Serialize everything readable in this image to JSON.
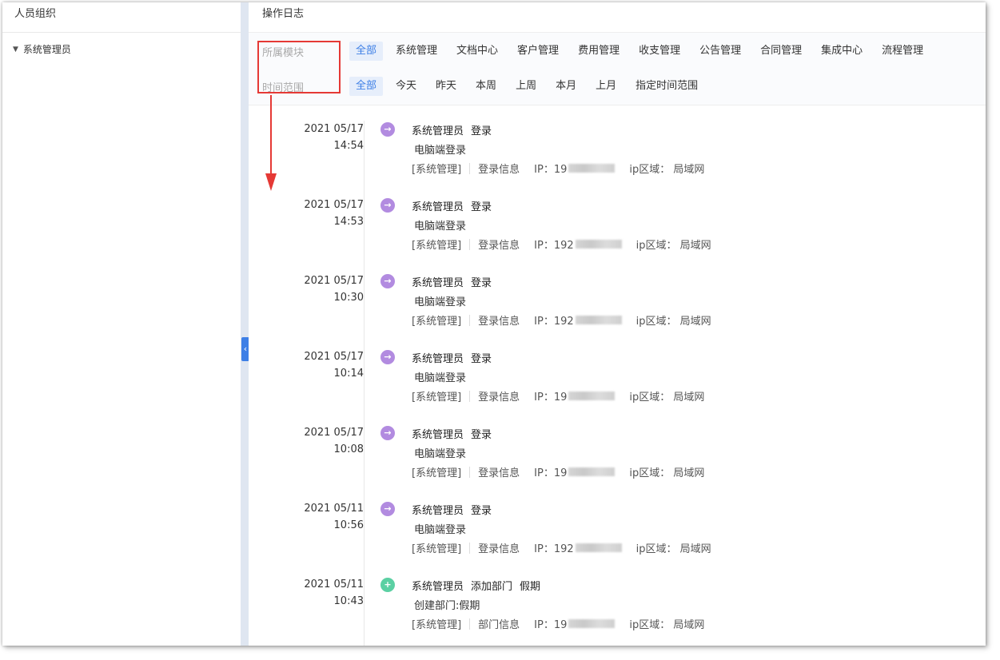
{
  "left_panel": {
    "title": "人员组织",
    "tree": [
      {
        "label": "系统管理员",
        "expanded": true
      }
    ]
  },
  "main": {
    "title": "操作日志",
    "filters": {
      "module_label": "所属模块",
      "modules": [
        "全部",
        "系统管理",
        "文档中心",
        "客户管理",
        "费用管理",
        "收支管理",
        "公告管理",
        "合同管理",
        "集成中心",
        "流程管理"
      ],
      "time_label": "时间范围",
      "times": [
        "全部",
        "今天",
        "昨天",
        "本周",
        "上周",
        "本月",
        "上月",
        "指定时间范围"
      ]
    },
    "entries": [
      {
        "date": "2021 05/17",
        "time": "14:54",
        "type": "login",
        "user": "系统管理员",
        "action": "登录",
        "extra": "",
        "desc": "电脑端登录",
        "module": "[系统管理]",
        "category": "登录信息",
        "ip": "IP：19",
        "region": "ip区域： 局域网"
      },
      {
        "date": "2021 05/17",
        "time": "14:53",
        "type": "login",
        "user": "系统管理员",
        "action": "登录",
        "extra": "",
        "desc": "电脑端登录",
        "module": "[系统管理]",
        "category": "登录信息",
        "ip": "IP：192",
        "region": "ip区域： 局域网"
      },
      {
        "date": "2021 05/17",
        "time": "10:30",
        "type": "login",
        "user": "系统管理员",
        "action": "登录",
        "extra": "",
        "desc": "电脑端登录",
        "module": "[系统管理]",
        "category": "登录信息",
        "ip": "IP：192",
        "region": "ip区域： 局域网"
      },
      {
        "date": "2021 05/17",
        "time": "10:14",
        "type": "login",
        "user": "系统管理员",
        "action": "登录",
        "extra": "",
        "desc": "电脑端登录",
        "module": "[系统管理]",
        "category": "登录信息",
        "ip": "IP：19",
        "region": "ip区域： 局域网"
      },
      {
        "date": "2021 05/17",
        "time": "10:08",
        "type": "login",
        "user": "系统管理员",
        "action": "登录",
        "extra": "",
        "desc": "电脑端登录",
        "module": "[系统管理]",
        "category": "登录信息",
        "ip": "IP：19",
        "region": "ip区域： 局域网"
      },
      {
        "date": "2021 05/11",
        "time": "10:56",
        "type": "login",
        "user": "系统管理员",
        "action": "登录",
        "extra": "",
        "desc": "电脑端登录",
        "module": "[系统管理]",
        "category": "登录信息",
        "ip": "IP：192",
        "region": "ip区域： 局域网"
      },
      {
        "date": "2021 05/11",
        "time": "10:43",
        "type": "add",
        "user": "系统管理员",
        "action": "添加部门",
        "extra": "假期",
        "desc": "创建部门:假期",
        "module": "[系统管理]",
        "category": "部门信息",
        "ip": "IP：19",
        "region": "ip区域： 局域网"
      }
    ]
  },
  "icons": {
    "login": "arrow-right-circle-icon",
    "add": "plus-circle-icon",
    "collapse": "chevron-left-icon"
  },
  "colors": {
    "accent": "#3d7fe6",
    "login_dot": "#b28be0",
    "add_dot": "#5bd0a3",
    "annotation": "#e53935"
  }
}
